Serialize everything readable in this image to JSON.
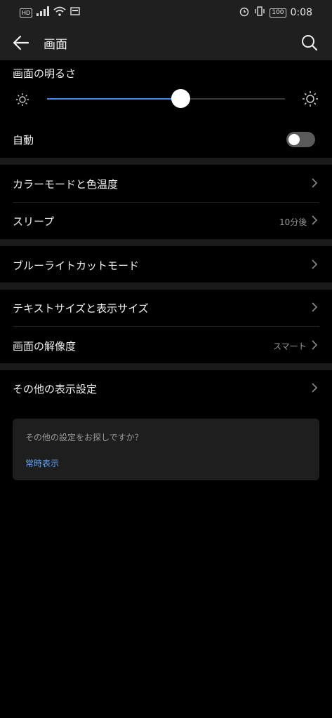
{
  "status_bar": {
    "hd_label": "HD",
    "battery_level": "100",
    "time": "0:08",
    "icons": [
      "signal-icon",
      "wifi-icon",
      "screen-icon",
      "alarm-icon",
      "vibrate-icon",
      "battery-icon"
    ]
  },
  "header": {
    "title": "画面",
    "back_icon": "back-arrow-icon",
    "search_icon": "search-icon"
  },
  "brightness": {
    "label": "画面の明るさ",
    "level_fraction": 0.56,
    "accent_color": "#3d8bf2"
  },
  "auto": {
    "label": "自動",
    "enabled": false
  },
  "settings": {
    "color_mode": {
      "label": "カラーモードと色温度"
    },
    "sleep": {
      "label": "スリープ",
      "value": "10分後"
    },
    "blue_light": {
      "label": "ブルーライトカットモード"
    },
    "text_size": {
      "label": "テキストサイズと表示サイズ"
    },
    "resolution": {
      "label": "画面の解像度",
      "value": "スマート"
    },
    "other_display": {
      "label": "その他の表示設定"
    }
  },
  "suggestion_card": {
    "question": "その他の設定をお探しですか？",
    "link": "常時表示",
    "link_color": "#5aa2f5"
  }
}
